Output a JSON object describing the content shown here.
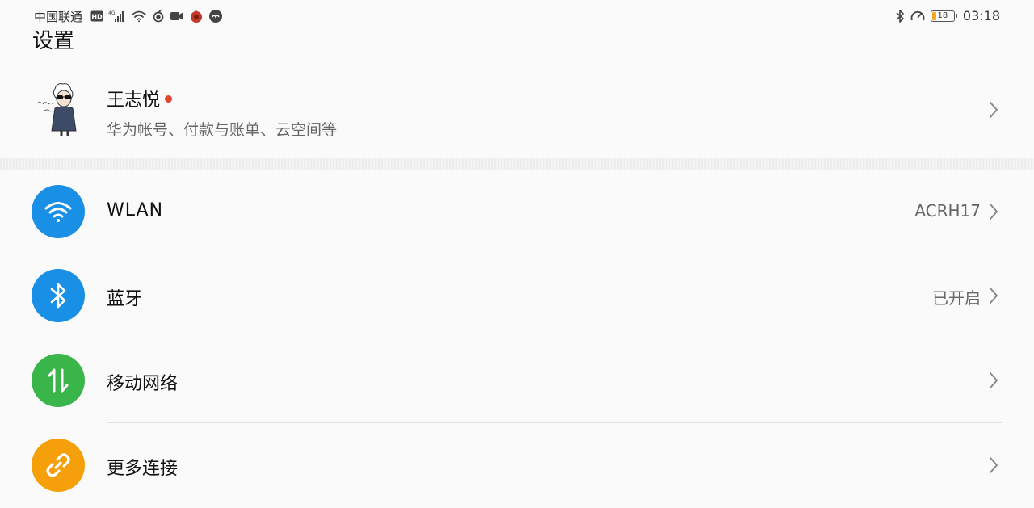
{
  "status_bar": {
    "carrier": "中国联通",
    "network": "4G",
    "time": "03:18",
    "battery_level": "18"
  },
  "page_title": "设置",
  "account": {
    "name": "王志悦",
    "subtitle": "华为帐号、付款与账单、云空间等"
  },
  "settings": [
    {
      "label": "WLAN",
      "value": "ACRH17",
      "icon": "wifi-icon",
      "color": "#1a8fe6"
    },
    {
      "label": "蓝牙",
      "value": "已开启",
      "icon": "bluetooth-icon",
      "color": "#1a8fe6"
    },
    {
      "label": "移动网络",
      "value": "",
      "icon": "mobile-network-icon",
      "color": "#3ab54a"
    },
    {
      "label": "更多连接",
      "value": "",
      "icon": "link-icon",
      "color": "#f59f0b"
    }
  ],
  "colors": {
    "background": "#fafafa",
    "accent_blue": "#1a8fe6",
    "accent_green": "#3ab54a",
    "accent_orange": "#f59f0b",
    "notification_dot": "#e8432e"
  }
}
